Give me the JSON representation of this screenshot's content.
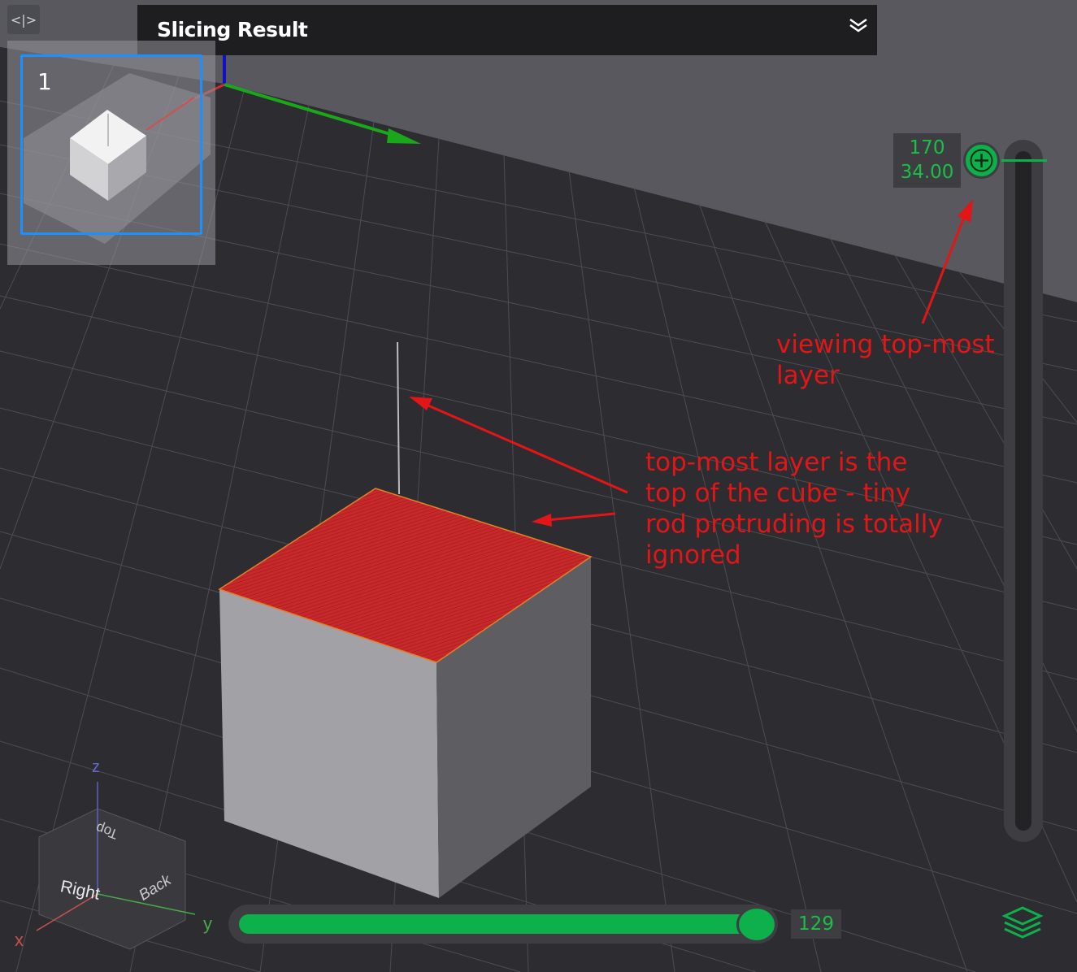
{
  "app": {
    "panel_title": "Slicing Result",
    "plate_number": "1"
  },
  "layer_slider": {
    "layer": "170",
    "height": "34.00"
  },
  "move_slider": {
    "value": "129",
    "progress_fraction": 0.95
  },
  "view_cube": {
    "top": "Top",
    "right": "Right",
    "back": "Back",
    "axis_z": "z",
    "axis_y": "y",
    "axis_x": "x"
  },
  "annotations": {
    "note_1": [
      "viewing top-most",
      "layer"
    ],
    "note_2": [
      "top-most layer is the",
      "top of the cube - tiny",
      "rod protruding is totally",
      "ignored"
    ]
  },
  "colors": {
    "accent_green": "#0db04b",
    "annotation_red": "#e21616",
    "plate_selection_blue": "#1e8fff",
    "top_layer_red": "#c8282a"
  },
  "icons": {
    "collapse_toolbar": "collapse-toolbar-icon",
    "panel_toggle": "double-chevron-down-icon",
    "add_pause": "plus-icon",
    "layers": "layers-icon"
  }
}
